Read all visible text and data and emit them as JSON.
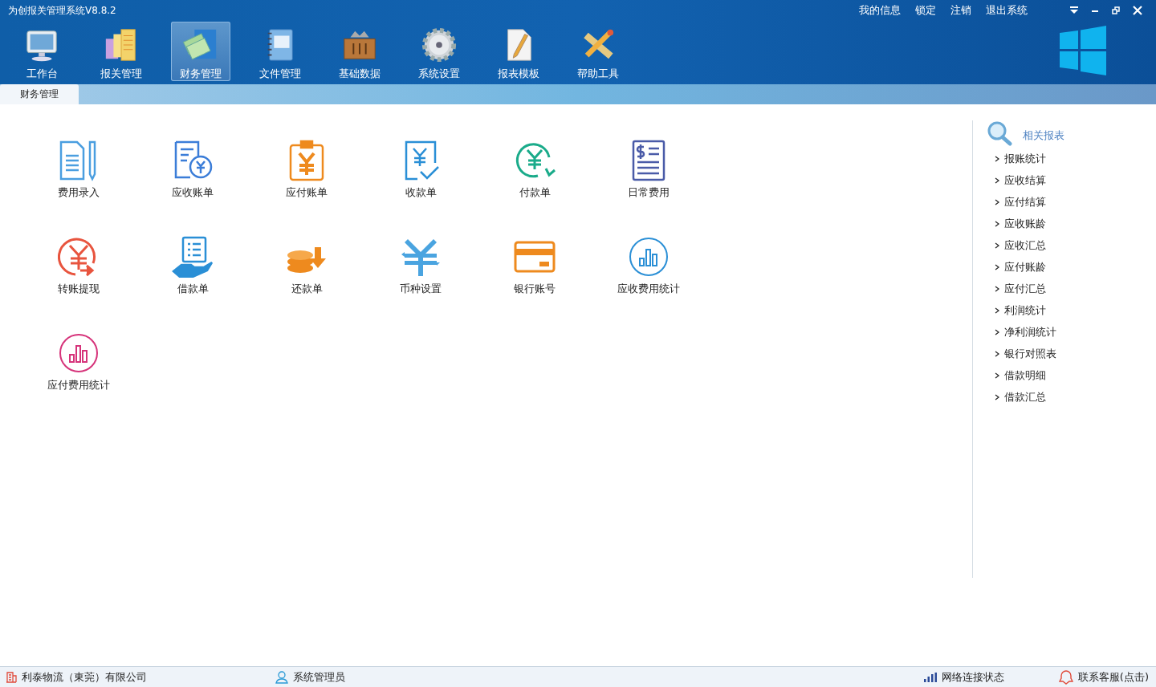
{
  "window": {
    "title": "为创报关管理系统V8.8.2"
  },
  "top_links": [
    "我的信息",
    "锁定",
    "注销",
    "退出系统"
  ],
  "toolbar": [
    {
      "label": "工作台",
      "kind": "monitor",
      "selected": false
    },
    {
      "label": "报关管理",
      "kind": "sheets",
      "selected": false
    },
    {
      "label": "财务管理",
      "kind": "money",
      "selected": true
    },
    {
      "label": "文件管理",
      "kind": "notebook",
      "selected": false
    },
    {
      "label": "基础数据",
      "kind": "toolbox",
      "selected": false
    },
    {
      "label": "系统设置",
      "kind": "gear",
      "selected": false
    },
    {
      "label": "报表模板",
      "kind": "document",
      "selected": false
    },
    {
      "label": "帮助工具",
      "kind": "ruler",
      "selected": false
    }
  ],
  "tabs": [
    {
      "label": "财务管理",
      "selected": true
    }
  ],
  "functions": [
    {
      "label": "费用录入",
      "kind": "doc-pen"
    },
    {
      "label": "应收账单",
      "kind": "bill-coin"
    },
    {
      "label": "应付账单",
      "kind": "clipboard-yen"
    },
    {
      "label": "收款单",
      "kind": "yen-check"
    },
    {
      "label": "付款单",
      "kind": "yen-cycle"
    },
    {
      "label": "日常费用",
      "kind": "dollar-list"
    },
    {
      "label": "转账提现",
      "kind": "yen-arrow"
    },
    {
      "label": "借款单",
      "kind": "hand-list"
    },
    {
      "label": "还款单",
      "kind": "coins-down"
    },
    {
      "label": "币种设置",
      "kind": "yen-swap"
    },
    {
      "label": "银行账号",
      "kind": "card"
    },
    {
      "label": "应收费用统计",
      "kind": "chart-blue"
    },
    {
      "label": "应付费用统计",
      "kind": "chart-pink"
    }
  ],
  "reports": {
    "title": "相关报表",
    "items": [
      "报账统计",
      "应收结算",
      "应付结算",
      "应收账龄",
      "应收汇总",
      "应付账龄",
      "应付汇总",
      "利润统计",
      "净利润统计",
      "银行对照表",
      "借款明细",
      "借款汇总"
    ]
  },
  "status_bar": {
    "company": "利泰物流（東莞）有限公司",
    "user": "系统管理员",
    "network": "网络连接状态",
    "support": "联系客服(点击)"
  }
}
